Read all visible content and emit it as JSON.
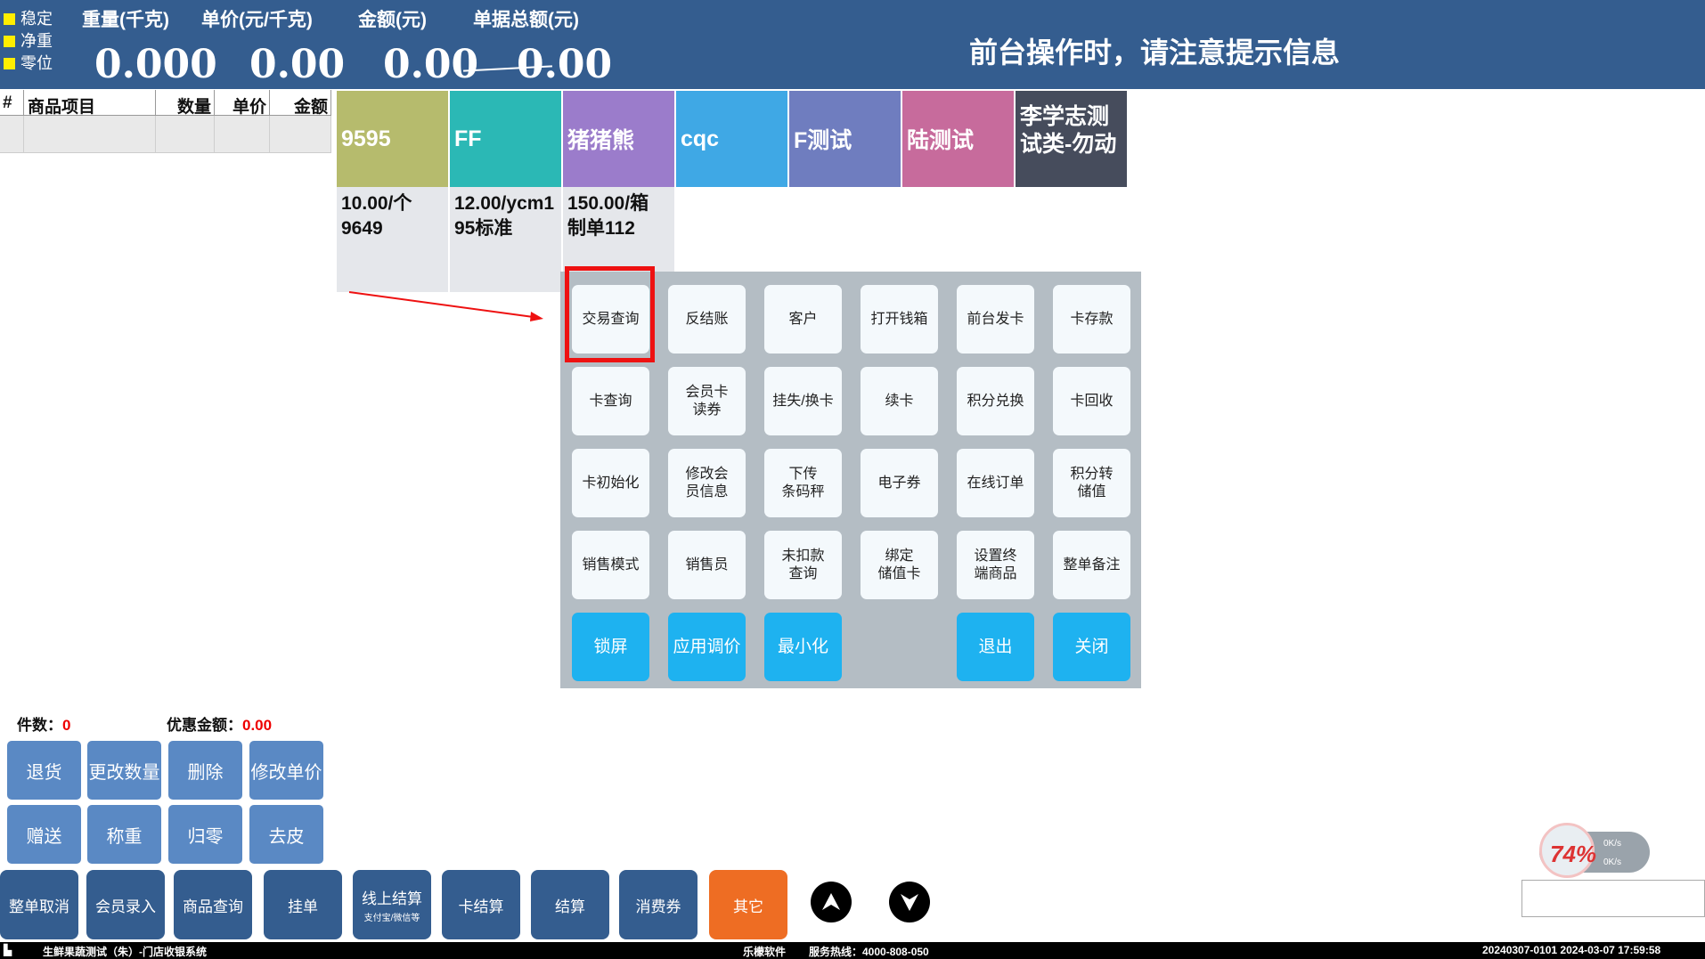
{
  "header": {
    "indicators": [
      "稳定",
      "净重",
      "零位"
    ],
    "labels": {
      "weight": "重量(千克)",
      "unit_price": "单价(元/千克)",
      "amount": "金额(元)",
      "total": "单据总额(元)"
    },
    "values": {
      "weight": "0.000",
      "unit_price": "0.00",
      "amount": "0.00",
      "total": "0.00"
    },
    "notice": "前台操作时，请注意提示信息"
  },
  "order_table": {
    "columns": [
      "#",
      "商品项目",
      "数量",
      "单价",
      "金额"
    ]
  },
  "products": [
    {
      "name": "9595",
      "price": "10.00/个",
      "code": "9649",
      "color": "#b6bb6d"
    },
    {
      "name": "FF",
      "price": "12.00/ycm1",
      "code": "95标准",
      "color": "#2bb8b5"
    },
    {
      "name": "猪猪熊",
      "price": "150.00/箱",
      "code": "制单112",
      "color": "#9b7ccb"
    },
    {
      "name": "cqc",
      "color": "#3fa8e5"
    },
    {
      "name": "F测试",
      "color": "#6f7dbf"
    },
    {
      "name": "陆测试",
      "color": "#c76b9c"
    },
    {
      "name": "李学志测试类-勿动",
      "color": "#464c5c"
    }
  ],
  "panel": {
    "rows": [
      [
        "交易查询",
        "反结账",
        "客户",
        "打开钱箱",
        "前台发卡",
        "卡存款"
      ],
      [
        "卡查询",
        "会员卡\n读券",
        "挂失/换卡",
        "续卡",
        "积分兑换",
        "卡回收"
      ],
      [
        "卡初始化",
        "修改会\n员信息",
        "下传\n条码秤",
        "电子券",
        "在线订单",
        "积分转\n储值"
      ],
      [
        "销售模式",
        "销售员",
        "未扣款\n查询",
        "绑定\n储值卡",
        "设置终\n端商品",
        "整单备注"
      ]
    ],
    "action_row": [
      "锁屏",
      "应用调价",
      "最小化",
      "",
      "退出",
      "关闭"
    ]
  },
  "summary": {
    "count_label": "件数：",
    "count_value": "0",
    "discount_label": "优惠金额：",
    "discount_value": "0.00"
  },
  "controls": {
    "row1": [
      "退货",
      "更改数量",
      "删除",
      "修改单价"
    ],
    "row2": [
      "赠送",
      "称重",
      "归零",
      "去皮"
    ]
  },
  "bottom_bar": {
    "buttons": [
      "整单取消",
      "会员录入",
      "商品查询",
      "挂单",
      "线上结算",
      "卡结算",
      "结算",
      "消费券",
      "其它"
    ],
    "online_sub": "支付宝/微信等"
  },
  "net_gauge": {
    "percent": "74%",
    "up": "0K/s",
    "down": "0K/s"
  },
  "status_bar": {
    "app": "生鲜果蔬测试（朱）-门店收银系统",
    "vendor": "乐檬软件",
    "hotline": "服务热线：4000-808-050",
    "datetime": "20240307-0101 2024-03-07 17:59:58"
  },
  "colors": {
    "header_bg": "#345d8f",
    "panel_bg": "#b4bdc4",
    "accent_blue": "#1eb2f0",
    "other_orange": "#ee6d23",
    "highlight_red": "#ee1111"
  }
}
